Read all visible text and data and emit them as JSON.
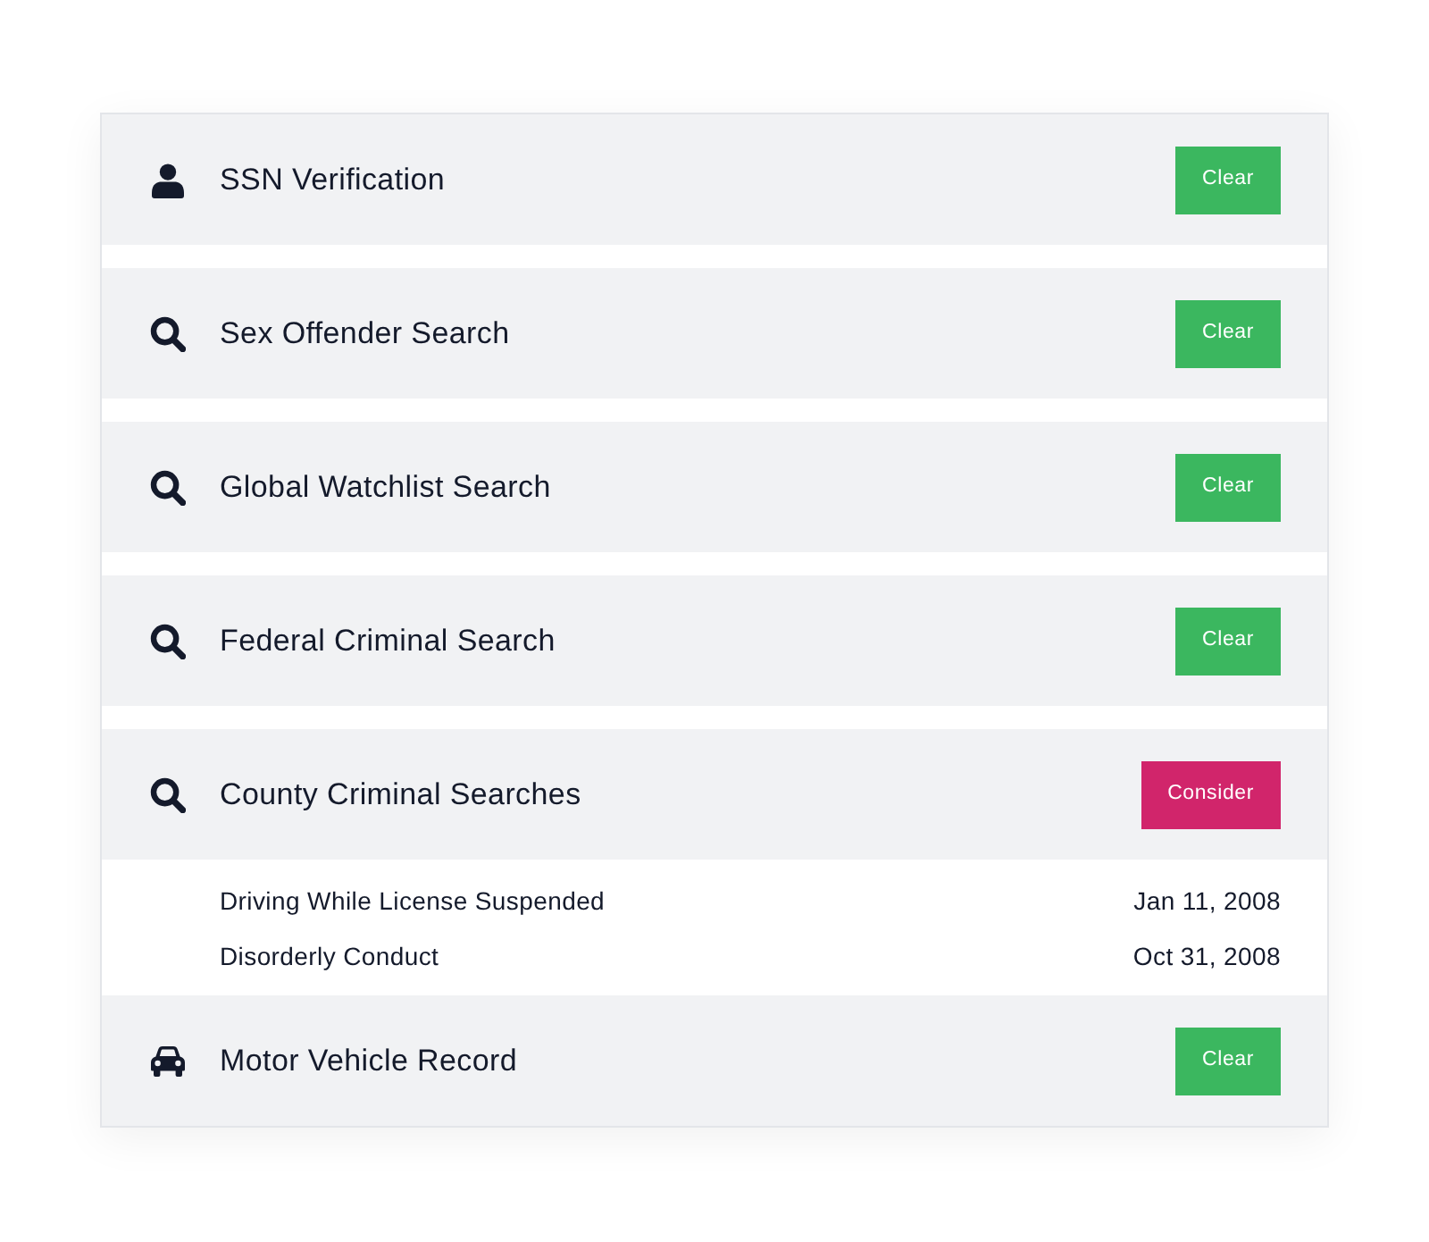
{
  "checks": [
    {
      "kind": "identity",
      "title": "SSN Verification",
      "result": {
        "label": "Clear",
        "color": "#3bb75f"
      }
    },
    {
      "kind": "search",
      "title": "Sex Offender Search",
      "result": {
        "label": "Clear",
        "color": "#3bb75f"
      }
    },
    {
      "kind": "search",
      "title": "Global Watchlist Search",
      "result": {
        "label": "Clear",
        "color": "#3bb75f"
      }
    },
    {
      "kind": "search",
      "title": "Federal Criminal Search",
      "result": {
        "label": "Clear",
        "color": "#3bb75f"
      }
    },
    {
      "kind": "search",
      "title": "County Criminal Searches",
      "result": {
        "label": "Consider",
        "color": "#d1256b"
      },
      "records": [
        {
          "offense": "Driving While License Suspended",
          "date": "Jan 11, 2008"
        },
        {
          "offense": "Disorderly Conduct",
          "date": "Oct 31, 2008"
        }
      ]
    },
    {
      "kind": "vehicle",
      "title": "Motor Vehicle Record",
      "result": {
        "label": "Clear",
        "color": "#3bb75f"
      }
    }
  ]
}
